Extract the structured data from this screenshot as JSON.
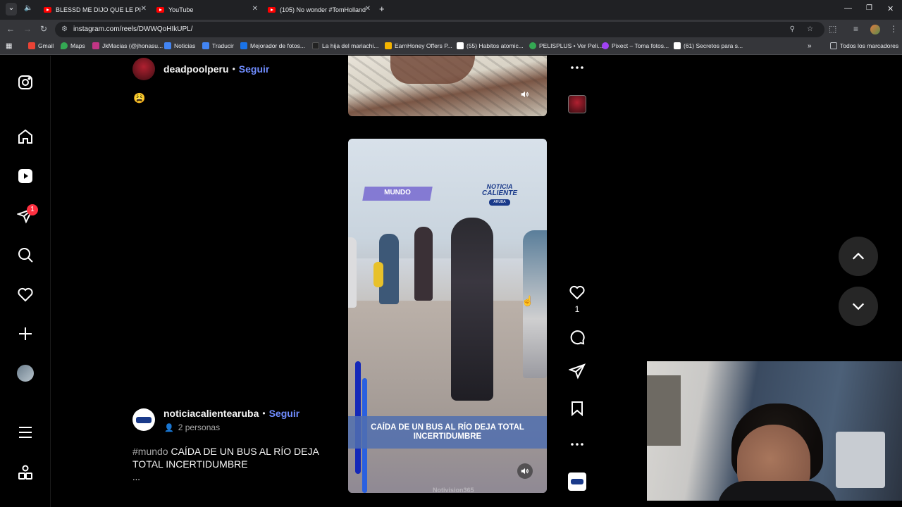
{
  "tabs": [
    {
      "title": "BLESSD ME DIJO QUE LE PI",
      "active": false
    },
    {
      "title": "YouTube",
      "active": false
    },
    {
      "title": "(105) No wonder #TomHolland",
      "active": false
    }
  ],
  "address": {
    "url": "instagram.com/reels/DWWQoHIkUPL/"
  },
  "bookmarks": [
    {
      "label": "Gmail",
      "color": "#ea4335"
    },
    {
      "label": "Maps",
      "color": "#34a853"
    },
    {
      "label": "JkMacias (@jhonasu...",
      "color": "#c13584"
    },
    {
      "label": "Noticias",
      "color": "#4285f4"
    },
    {
      "label": "Traducir",
      "color": "#4285f4"
    },
    {
      "label": "Mejorador de fotos...",
      "color": "#1a73e8"
    },
    {
      "label": "La hija del mariachi...",
      "color": "#222222"
    },
    {
      "label": "EarnHoney Offers P...",
      "color": "#f4b400"
    },
    {
      "label": "(55) Habitos atomic...",
      "color": "#ffffff"
    },
    {
      "label": "PELISPLUS • Ver Peli...",
      "color": "#34a853"
    },
    {
      "label": "Pixect – Toma fotos...",
      "color": "#a142f4"
    },
    {
      "label": "(61) Secretos para s...",
      "color": "#ffffff"
    }
  ],
  "all_bookmarks_label": "Todos los marcadores",
  "sidebar": {
    "icons": [
      "instagram-logo-icon",
      "home-icon",
      "reels-icon",
      "messages-icon",
      "search-icon",
      "notifications-icon",
      "create-icon",
      "profile-avatar",
      "more-menu-icon",
      "apps-icon"
    ],
    "message_badge": "1"
  },
  "post1": {
    "username": "deadpoolperu",
    "separator": "•",
    "follow_label": "Seguir",
    "caption": "😩"
  },
  "post2": {
    "username": "noticiacalientearuba",
    "separator": "•",
    "follow_label": "Seguir",
    "collab": "2 personas",
    "hashtag": "#mundo",
    "caption": "CAÍDA DE UN BUS AL RÍO DEJA TOTAL INCERTIDUMBRE",
    "more": "..."
  },
  "reel2": {
    "tag": "MUNDO",
    "brand_line1": "NOTICIA",
    "brand_line2": "CALIENTE",
    "brand_line3": "ARUBA",
    "headline": "CAÍDA DE UN BUS AL RÍO DEJA TOTAL INCERTIDUMBRE",
    "watermark": "Notivision365"
  },
  "actions": {
    "like_count": "1"
  },
  "colors": {
    "accent": "#708dff",
    "badge": "#ff3040",
    "tag_bg": "#7b6fd0",
    "headline_bg": "#5a74b8"
  }
}
